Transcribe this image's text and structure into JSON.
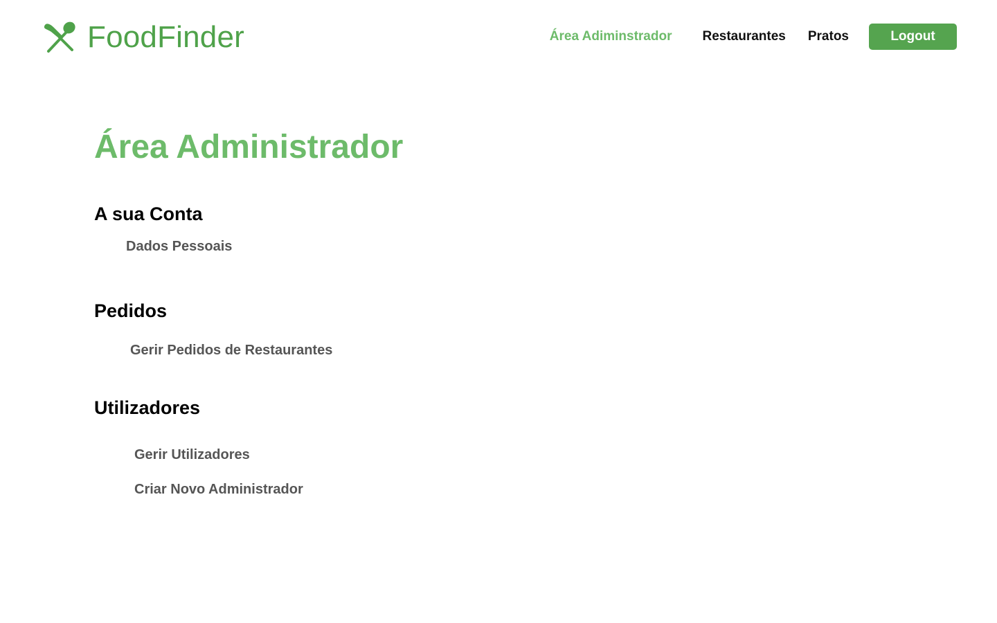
{
  "header": {
    "brand": "FoodFinder",
    "logo_icon": "fork-and-spoon-icon",
    "brand_color": "#4fa24a",
    "nav": {
      "admin_label": "Área Adiminstrador",
      "restaurants_label": "Restaurantes",
      "dishes_label": "Pratos"
    },
    "logout_label": "Logout",
    "accent_color": "#55a44f"
  },
  "main": {
    "title": "Área Administrador",
    "title_color": "#6dbb6a",
    "sections": [
      {
        "title": "A sua Conta",
        "links": [
          "Dados Pessoais"
        ]
      },
      {
        "title": "Pedidos",
        "links": [
          "Gerir Pedidos de Restaurantes"
        ]
      },
      {
        "title": "Utilizadores",
        "links": [
          "Gerir Utilizadores",
          "Criar Novo Administrador"
        ]
      }
    ]
  }
}
